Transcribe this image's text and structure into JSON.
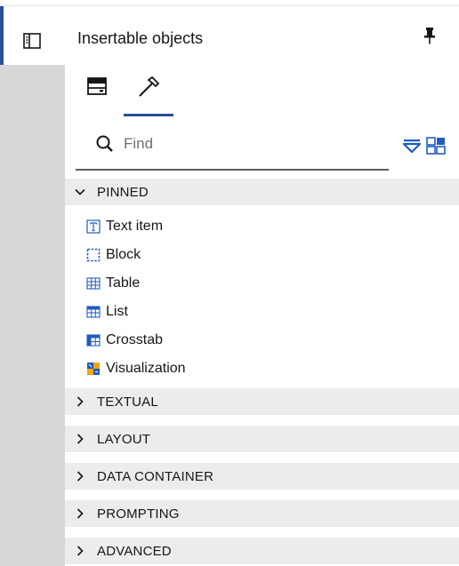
{
  "panel": {
    "title": "Insertable objects",
    "pin_icon": "pin-icon",
    "rail_icon": "side-panel-icon"
  },
  "tabs": [
    {
      "name": "toolbox-tab",
      "icon": "data-items-icon",
      "selected": false
    },
    {
      "name": "hammer-tab",
      "icon": "hammer-icon",
      "selected": true
    }
  ],
  "search": {
    "placeholder": "Find",
    "value": ""
  },
  "pinned": {
    "label": "PINNED",
    "expanded": true,
    "items": [
      {
        "label": "Text item",
        "icon": "text-item-icon"
      },
      {
        "label": "Block",
        "icon": "block-icon"
      },
      {
        "label": "Table",
        "icon": "table-icon"
      },
      {
        "label": "List",
        "icon": "list-icon"
      },
      {
        "label": "Crosstab",
        "icon": "crosstab-icon"
      },
      {
        "label": "Visualization",
        "icon": "visualization-icon"
      }
    ]
  },
  "groups": [
    {
      "label": "TEXTUAL",
      "expanded": false
    },
    {
      "label": "LAYOUT",
      "expanded": false
    },
    {
      "label": "DATA CONTAINER",
      "expanded": false
    },
    {
      "label": "PROMPTING",
      "expanded": false
    },
    {
      "label": "ADVANCED",
      "expanded": false
    }
  ],
  "colors": {
    "accent": "#2a4f9b",
    "rail": "#d8d8d8",
    "group_bg": "#ececec",
    "icon_blue": "#1f5bbf"
  }
}
